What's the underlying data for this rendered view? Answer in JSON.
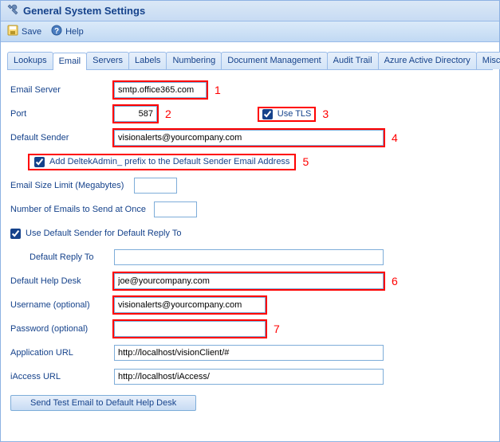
{
  "window": {
    "title": "General System Settings"
  },
  "toolbar": {
    "save": "Save",
    "help": "Help"
  },
  "tabs": {
    "items": [
      "Lookups",
      "Email",
      "Servers",
      "Labels",
      "Numbering",
      "Document Management",
      "Audit Trail",
      "Azure Active Directory",
      "Miscellaneous"
    ],
    "active_index": 1
  },
  "form": {
    "email_server": {
      "label": "Email Server",
      "value": "smtp.office365.com"
    },
    "port": {
      "label": "Port",
      "value": "587"
    },
    "use_tls": {
      "label": "Use TLS",
      "checked": true
    },
    "default_sender": {
      "label": "Default Sender",
      "value": "visionalerts@yourcompany.com"
    },
    "add_prefix": {
      "label": "Add DeltekAdmin_ prefix to the Default Sender Email Address",
      "checked": true
    },
    "email_size_limit": {
      "label": "Email Size Limit (Megabytes)",
      "value": ""
    },
    "num_emails": {
      "label": "Number of Emails to Send at Once",
      "value": ""
    },
    "use_default_reply": {
      "label": "Use Default Sender for Default Reply To",
      "checked": true
    },
    "default_reply_to": {
      "label": "Default Reply To",
      "value": ""
    },
    "default_help_desk": {
      "label": "Default Help Desk",
      "value": "joe@yourcompany.com"
    },
    "username": {
      "label": "Username (optional)",
      "value": "visionalerts@yourcompany.com"
    },
    "password": {
      "label": "Password (optional)",
      "value": ""
    },
    "app_url": {
      "label": "Application URL",
      "value": "http://localhost/visionClient/#"
    },
    "iaccess_url": {
      "label": "iAccess URL",
      "value": "http://localhost/iAccess/"
    },
    "send_test": "Send Test Email to Default Help Desk"
  },
  "annotations": {
    "a1": "1",
    "a2": "2",
    "a3": "3",
    "a4": "4",
    "a5": "5",
    "a6": "6",
    "a7": "7"
  }
}
